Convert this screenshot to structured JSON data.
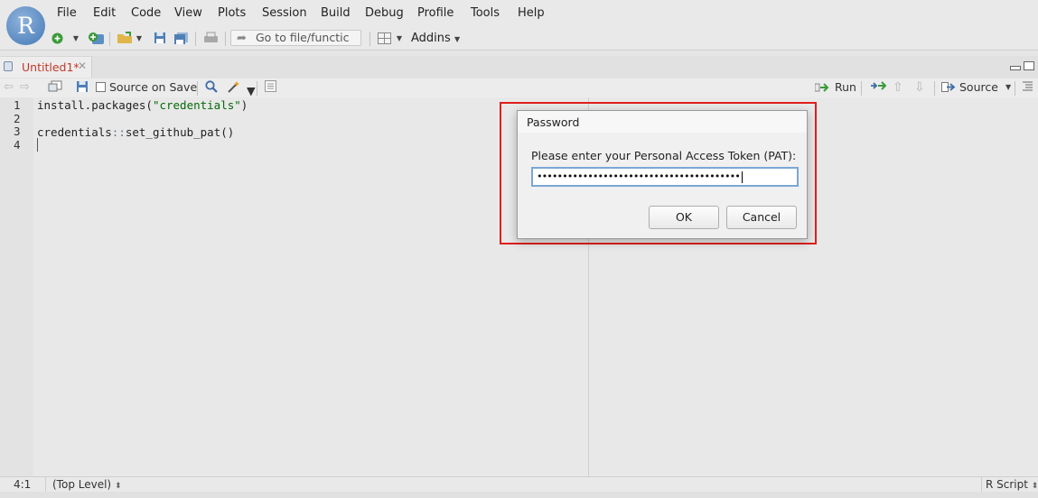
{
  "app": {
    "logo_letter": "R"
  },
  "menu": [
    "File",
    "Edit",
    "Code",
    "View",
    "Plots",
    "Session",
    "Build",
    "Debug",
    "Profile",
    "Tools",
    "Help"
  ],
  "toolbar": {
    "goto_placeholder": "Go to file/functic",
    "addins_label": "Addins"
  },
  "editor_tab": {
    "label": "Untitled1*"
  },
  "editor_toolbar": {
    "source_on_save": "Source on Save",
    "run": "Run",
    "source": "Source"
  },
  "code": {
    "line_numbers": [
      "1",
      "2",
      "3",
      "4"
    ],
    "line1_fn": "install.packages(",
    "line1_str": "\"credentials\"",
    "line1_end": ")",
    "line3_pkg": "credentials",
    "line3_op": "::",
    "line3_fn": "set_github_pat()"
  },
  "status": {
    "position": "4:1",
    "scope": "(Top Level)",
    "filetype": "R Script"
  },
  "dialog": {
    "title": "Password",
    "prompt": "Please enter your Personal Access Token (PAT):",
    "masked_value": "••••••••••••••••••••••••••••••••••••••••",
    "ok": "OK",
    "cancel": "Cancel"
  },
  "colors": {
    "highlight": "#e01e1e",
    "tab_modified": "#c0392b",
    "string": "#036a07"
  }
}
